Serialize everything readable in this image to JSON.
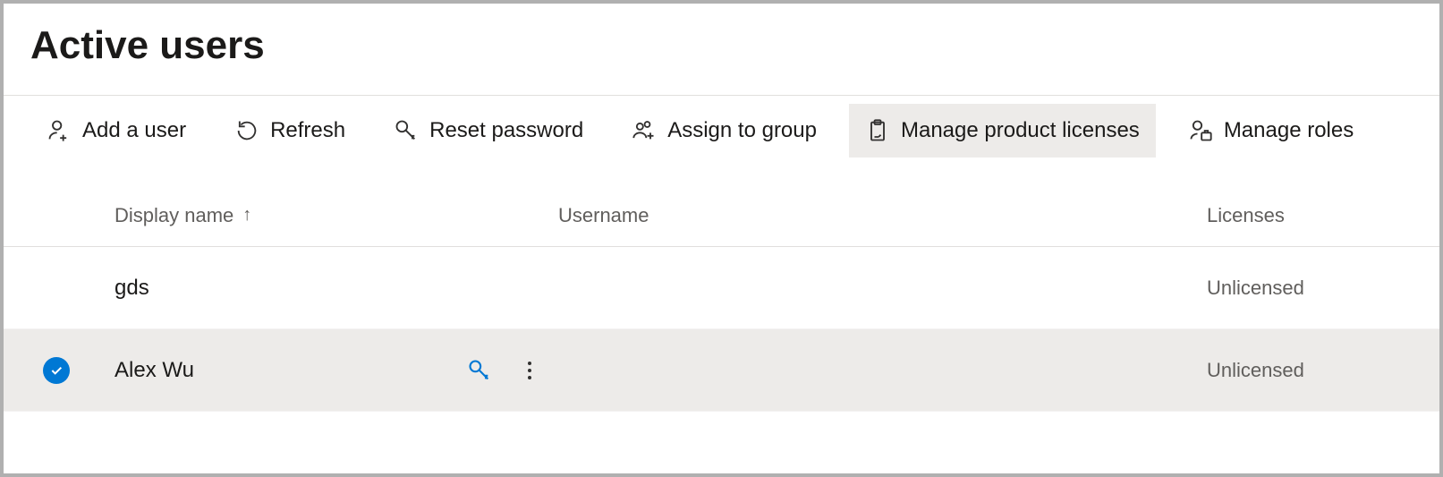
{
  "title": "Active users",
  "toolbar": {
    "add_user": "Add a user",
    "refresh": "Refresh",
    "reset_password": "Reset password",
    "assign_group": "Assign to group",
    "manage_licenses": "Manage product licenses",
    "manage_roles": "Manage roles"
  },
  "columns": {
    "display_name": "Display name",
    "username": "Username",
    "licenses": "Licenses"
  },
  "rows": [
    {
      "display_name": "gds",
      "username": "",
      "licenses": "Unlicensed",
      "selected": false
    },
    {
      "display_name": "Alex Wu",
      "username": "",
      "licenses": "Unlicensed",
      "selected": true
    }
  ]
}
